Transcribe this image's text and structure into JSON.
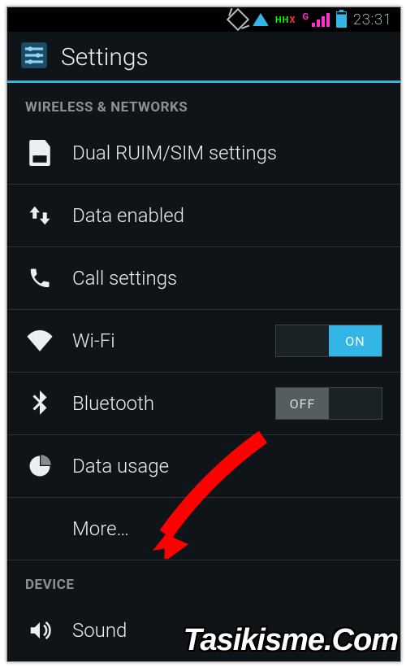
{
  "status": {
    "time": "23:31",
    "signal_label": "G",
    "indicator": "HH",
    "indicator_x": "X"
  },
  "title": "Settings",
  "sections": [
    {
      "header": "WIRELESS & NETWORKS"
    },
    {
      "header": "DEVICE"
    }
  ],
  "rows": {
    "dual_sim": {
      "label": "Dual RUIM/SIM settings"
    },
    "data": {
      "label": "Data enabled"
    },
    "call": {
      "label": "Call settings"
    },
    "wifi": {
      "label": "Wi-Fi",
      "toggle": "ON"
    },
    "bluetooth": {
      "label": "Bluetooth",
      "toggle": "OFF"
    },
    "usage": {
      "label": "Data usage"
    },
    "more": {
      "label": "More…"
    },
    "sound": {
      "label": "Sound"
    }
  },
  "toggle_labels": {
    "on": "ON",
    "off": "OFF"
  },
  "watermark": "Tasikisme.Com"
}
